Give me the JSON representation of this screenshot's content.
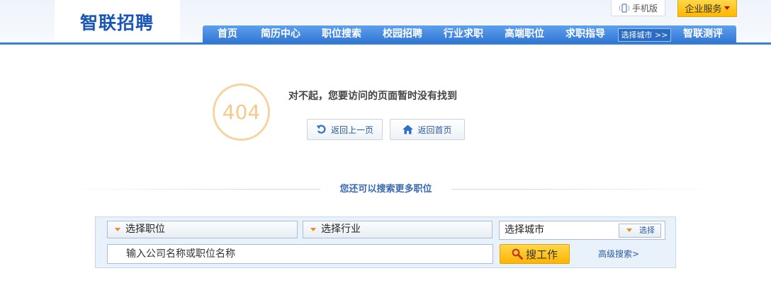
{
  "header": {
    "logo_text": "智联招聘",
    "mobile_label": "手机版",
    "enterprise_label": "企业服务"
  },
  "nav": {
    "items": [
      "首页",
      "简历中心",
      "职位搜索",
      "校园招聘",
      "行业求职",
      "高端职位",
      "求职指导"
    ],
    "city_button": "选择城市 >>",
    "last_item": "智联测评"
  },
  "error": {
    "code": "404",
    "message": "对不起，您要访问的页面暂时没有找到",
    "back_label": "返回上一页",
    "home_label": "返回首页"
  },
  "search": {
    "divider_text": "您还可以搜索更多职位",
    "job_select": "选择职位",
    "industry_select": "选择行业",
    "city_value": "选择城市",
    "city_button": "选择",
    "keyword_placeholder": "输入公司名称或职位名称",
    "search_button": "搜工作",
    "advanced_link": "高级搜索>"
  },
  "colors": {
    "nav_blue": "#3b7fd1",
    "accent_yellow": "#ffc619",
    "circle_orange": "#f8d39f"
  }
}
